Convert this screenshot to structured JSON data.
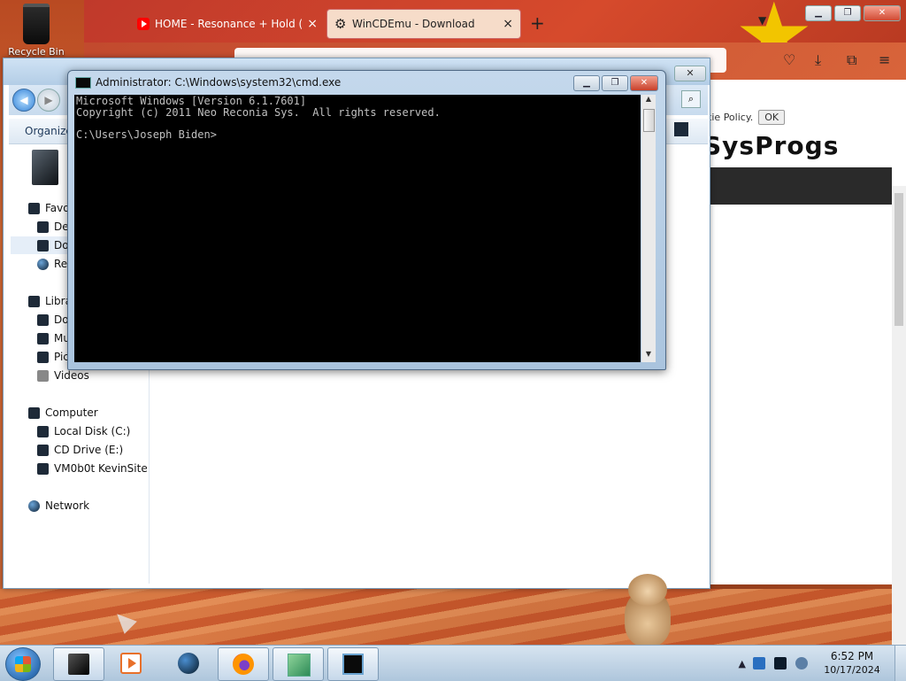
{
  "desktop": {
    "recycle_bin_label": "Recycle Bin"
  },
  "browser": {
    "tabs": [
      {
        "title": "HOME - Resonance + Hold (Va",
        "icon": "youtube-icon"
      },
      {
        "title": "WinCDEmu - Download",
        "icon": "gear-icon"
      }
    ],
    "tab_close": "×",
    "new_tab": "+",
    "cookie_text": "kie Policy.",
    "cookie_ok": "OK",
    "logo_text": "SysProgs"
  },
  "explorer": {
    "organize_label": "Organize",
    "favorites": [
      {
        "label": "Favo",
        "icon": "star-icon"
      },
      {
        "label": "De",
        "icon": "desktop-icon"
      },
      {
        "label": "Do",
        "icon": "downloads-icon"
      },
      {
        "label": "Re",
        "icon": "recent-icon"
      }
    ],
    "libraries": [
      {
        "label": "Libra",
        "icon": "library-icon"
      },
      {
        "label": "Do",
        "icon": "documents-icon"
      },
      {
        "label": "Mu",
        "icon": "music-icon"
      },
      {
        "label": "Pic",
        "icon": "pictures-icon"
      },
      {
        "label": "Videos",
        "icon": "videos-icon"
      }
    ],
    "computer": [
      {
        "label": "Computer",
        "icon": "computer-icon"
      },
      {
        "label": "Local Disk (C:)",
        "icon": "disk-icon"
      },
      {
        "label": "CD Drive (E:)",
        "icon": "cd-drive-icon"
      },
      {
        "label": "VM0b0t KevinSite",
        "icon": "network-drive-icon"
      }
    ],
    "network_label": "Network"
  },
  "cmd": {
    "title": "Administrator: C:\\Windows\\system32\\cmd.exe",
    "console_lines": [
      "Microsoft Windows [Version 6.1.7601]",
      "Copyright (c) 2011 Neo Reconia Sys.  All rights reserved.",
      "",
      "C:\\Users\\Joseph Biden>"
    ]
  },
  "taskbar": {
    "clock_time": "6:52 PM",
    "clock_date": "10/17/2024",
    "tray_expand": "▲",
    "pinned": [
      "explorer-icon",
      "media-player-icon",
      "globe-icon",
      "firefox-icon",
      "app-icon",
      "cmd-icon"
    ]
  }
}
